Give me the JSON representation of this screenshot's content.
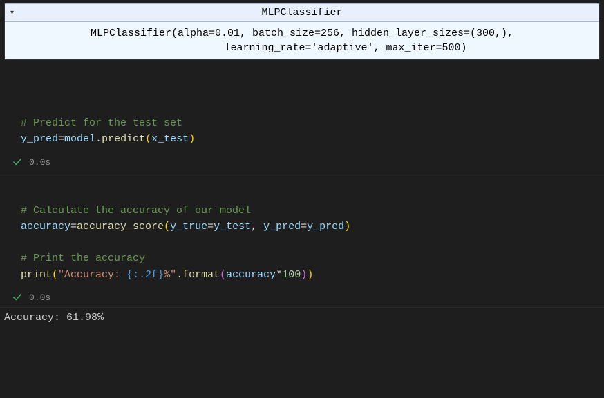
{
  "widget": {
    "title": "MLPClassifier",
    "repr": "MLPClassifier(alpha=0.01, batch_size=256, hidden_layer_sizes=(300,),\n              learning_rate='adaptive', max_iter=500)",
    "toggle_glyph": "▾"
  },
  "cells": [
    {
      "status_time": "0.0s",
      "code": {
        "comment1": "# Predict for the test set",
        "var_y_pred": "y_pred",
        "eq": "=",
        "obj_model": "model",
        "dot": ".",
        "fn_predict": "predict",
        "arg_x_test": "x_test"
      }
    },
    {
      "status_time": "0.0s",
      "code": {
        "comment1": "# Calculate the accuracy of our model",
        "var_accuracy": "accuracy",
        "eq": "=",
        "fn_accuracy_score": "accuracy_score",
        "kw_y_true": "y_true",
        "arg_y_test": "y_test",
        "comma": ", ",
        "kw_y_pred": "y_pred",
        "arg_y_pred": "y_pred",
        "comment2": "# Print the accuracy",
        "fn_print": "print",
        "str_open": "\"Accuracy: ",
        "fmt_open": "{",
        "fmt_spec": ":.2f",
        "fmt_close": "}",
        "str_close": "%\"",
        "dot": ".",
        "fn_format": "format",
        "var_acc2": "accuracy",
        "mul": "*",
        "num_100": "100"
      },
      "output": "Accuracy: 61.98%"
    }
  ]
}
